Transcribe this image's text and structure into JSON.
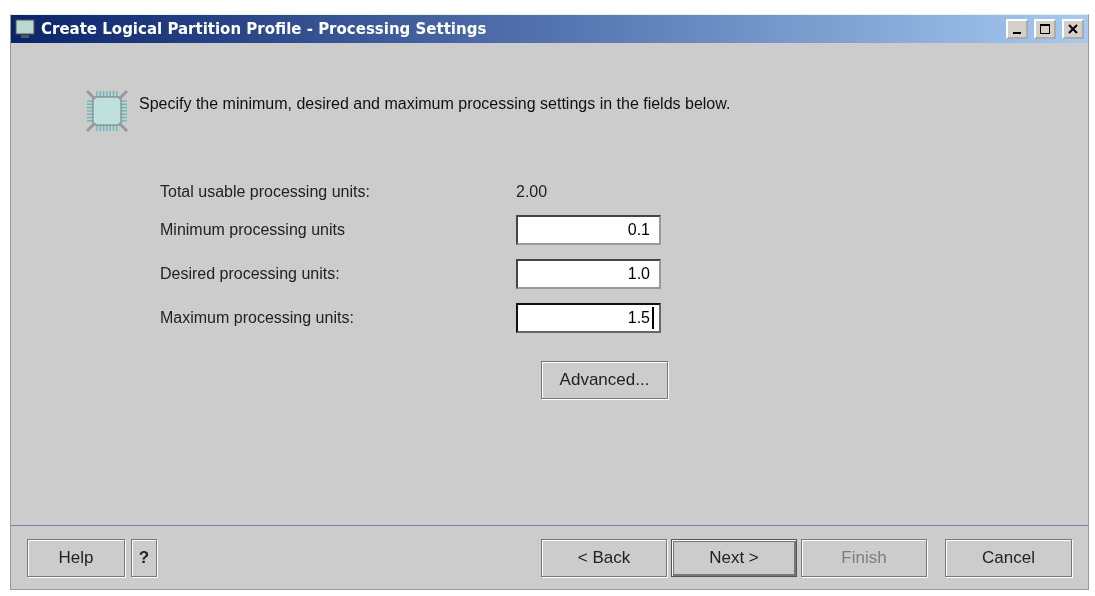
{
  "window": {
    "title": "Create Logical Partition Profile - Processing Settings",
    "controls": [
      {
        "kind": "minimize"
      },
      {
        "kind": "maximize"
      },
      {
        "kind": "close"
      }
    ]
  },
  "instruction": "Specify the minimum, desired and maximum processing settings in the fields below.",
  "total": {
    "label": "Total usable processing units:",
    "value": "2.00"
  },
  "fields": [
    {
      "label": "Minimum processing units",
      "value": "0.1",
      "focused": false
    },
    {
      "label": "Desired processing units:",
      "value": "1.0",
      "focused": false
    },
    {
      "label": "Maximum processing units:",
      "value": "1.5",
      "focused": true
    }
  ],
  "advanced_button": {
    "label": "Advanced..."
  },
  "help_buttons": [
    {
      "label": "Help"
    },
    {
      "label": "?"
    }
  ],
  "nav_buttons": [
    {
      "label": "< Back",
      "disabled": false,
      "default": false
    },
    {
      "label": "Next >",
      "disabled": false,
      "default": true
    },
    {
      "label": "Finish",
      "disabled": true,
      "default": false
    }
  ],
  "cancel_button": {
    "label": "Cancel"
  }
}
